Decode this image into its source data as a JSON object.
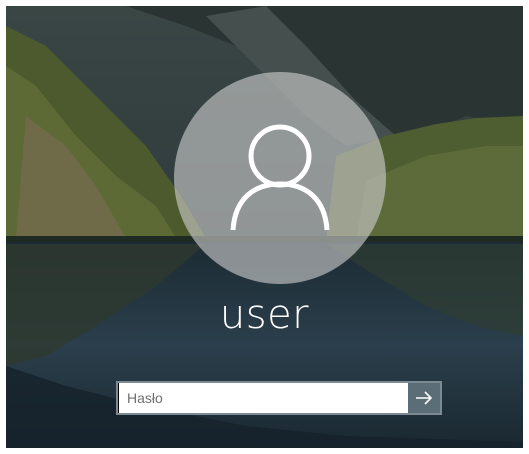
{
  "login": {
    "username": "user",
    "password_placeholder": "Hasło",
    "password_value": "",
    "avatar_icon": "user-silhouette-icon",
    "submit_icon": "arrow-right-icon"
  },
  "colors": {
    "avatar_bg": "#cdcdcd",
    "submit_bg": "#5b6e78",
    "text": "#ffffff"
  }
}
